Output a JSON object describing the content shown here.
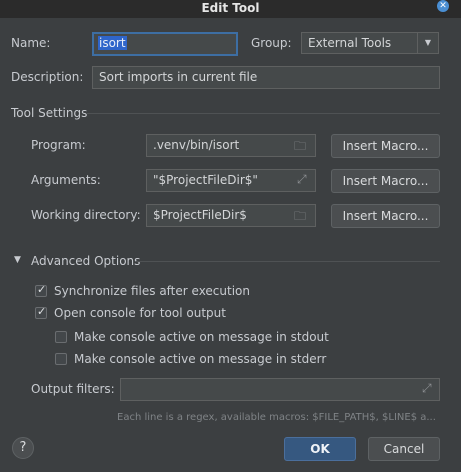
{
  "dialog": {
    "title": "Edit Tool",
    "close_icon": "close-icon"
  },
  "name": {
    "label": "Name:",
    "value": "isort"
  },
  "group": {
    "label": "Group:",
    "selected": "External Tools"
  },
  "description": {
    "label": "Description:",
    "value": "Sort imports in current file"
  },
  "tool_settings": {
    "title": "Tool Settings",
    "program": {
      "label": "Program:",
      "value": ".venv/bin/isort",
      "macro_button": "Insert Macro..."
    },
    "arguments": {
      "label": "Arguments:",
      "value": "\"$ProjectFileDir$\"",
      "macro_button": "Insert Macro..."
    },
    "working_directory": {
      "label": "Working directory:",
      "value": "$ProjectFileDir$",
      "macro_button": "Insert Macro..."
    }
  },
  "advanced": {
    "title": "Advanced Options",
    "sync_files": {
      "label": "Synchronize files after execution",
      "checked": true
    },
    "open_console": {
      "label": "Open console for tool output",
      "checked": true
    },
    "console_stdout": {
      "label": "Make console active on message in stdout",
      "checked": false
    },
    "console_stderr": {
      "label": "Make console active on message in stderr",
      "checked": false
    },
    "output_filters": {
      "label": "Output filters:",
      "value": ""
    },
    "hint": "Each line is a regex, available macros: $FILE_PATH$, $LINE$ a..."
  },
  "footer": {
    "help": "?",
    "ok": "OK",
    "cancel": "Cancel"
  }
}
